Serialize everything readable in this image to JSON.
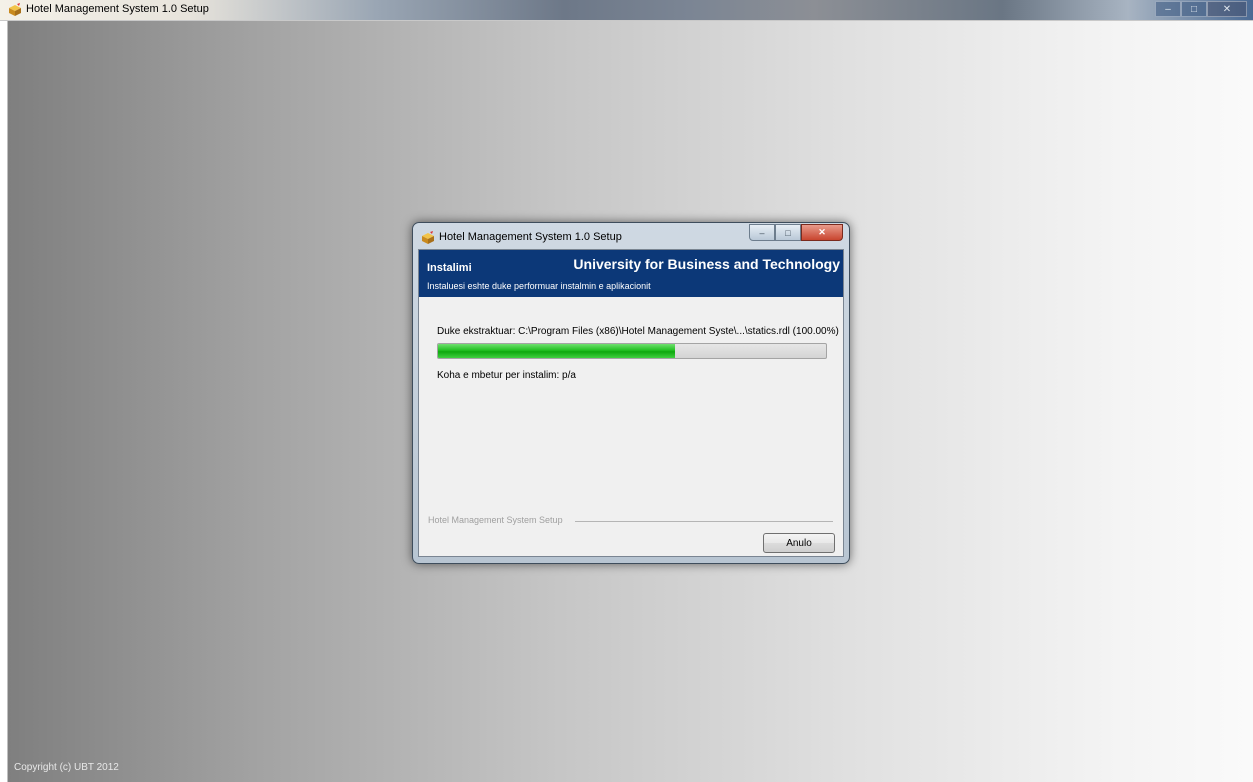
{
  "window": {
    "title": "Hotel Management System 1.0 Setup",
    "icon": "installer-box-icon",
    "controls": {
      "minimize": "–",
      "maximize": "□",
      "close": "✕"
    }
  },
  "background": {
    "copyright": "Copyright (c) UBT 2012"
  },
  "dialog": {
    "title": "Hotel Management System 1.0 Setup",
    "controls": {
      "minimize": "–",
      "maximize": "□",
      "close": "✕"
    },
    "header": {
      "step_title": "Instalimi",
      "brand": "University for Business and Technology",
      "subtitle": "Instaluesi eshte duke performuar instalmin e aplikacionit"
    },
    "status_text": "Duke ekstraktuar: C:\\Program Files (x86)\\Hotel Management Syste\\...\\statics.rdl (100.00%)",
    "progress_fraction": 0.61,
    "time_remaining": "Koha e mbetur per instalim: p/a",
    "footer_label": "Hotel Management System Setup",
    "cancel_label": "Anulo"
  },
  "colors": {
    "header_band": "#0c3878",
    "progress_green": "#22c022"
  }
}
